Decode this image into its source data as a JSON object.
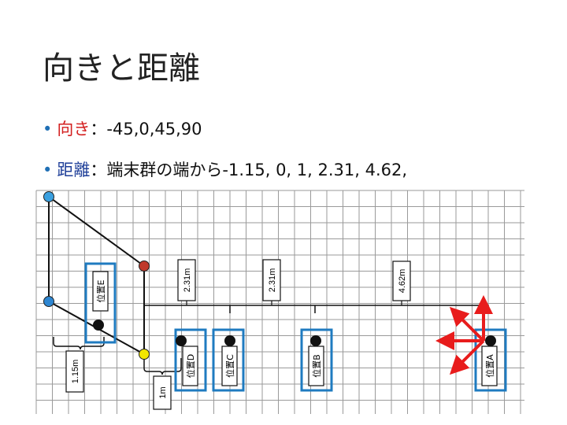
{
  "title": "向きと距離",
  "bullets": [
    {
      "keyword": "向き",
      "sep": "：",
      "text": "-45,0,45,90",
      "keyword_color": "#d32020"
    },
    {
      "keyword": "距離",
      "sep": "：",
      "text": "端末群の端から-1.15, 0, 1, 2.31, 4.62,",
      "keyword_color": "#1f3f99"
    }
  ],
  "diagram": {
    "positions": [
      "位置A",
      "位置B",
      "位置C",
      "位置D",
      "位置E"
    ],
    "distance_labels": [
      "2.31m",
      "2.31m",
      "4.62m",
      "1.15m",
      "1m"
    ],
    "colors": {
      "grid": "#9a9a9a",
      "box": "#1f7bc0",
      "arrow": "#e81c1c",
      "node_blue": "#2e86d1",
      "node_red": "#c0392b",
      "node_yellow": "#f2e600",
      "node_cyan": "#3aa0e0"
    }
  }
}
